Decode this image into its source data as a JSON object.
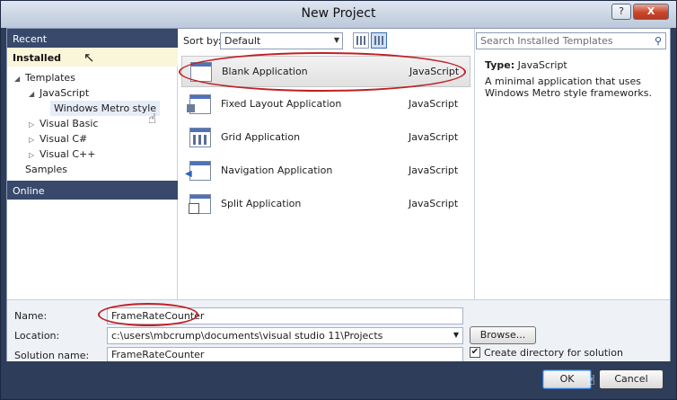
{
  "window": {
    "title": "New Project",
    "help_label": "?",
    "close_label": "X"
  },
  "sidebar": {
    "recent": "Recent",
    "installed": "Installed",
    "online": "Online",
    "tree": [
      {
        "label": "Templates",
        "expanded": true
      },
      {
        "label": "JavaScript",
        "expanded": true
      },
      {
        "label": "Windows Metro style",
        "selected": true
      },
      {
        "label": "Visual Basic",
        "expanded": false
      },
      {
        "label": "Visual C#",
        "expanded": false
      },
      {
        "label": "Visual C++",
        "expanded": false
      },
      {
        "label": "Samples"
      }
    ]
  },
  "toolbar": {
    "sort_label": "Sort by:",
    "sort_value": "Default"
  },
  "templates": [
    {
      "name": "Blank Application",
      "language": "JavaScript",
      "icon": "blank-app-icon",
      "selected": true
    },
    {
      "name": "Fixed Layout Application",
      "language": "JavaScript",
      "icon": "fixed-layout-app-icon"
    },
    {
      "name": "Grid Application",
      "language": "JavaScript",
      "icon": "grid-app-icon"
    },
    {
      "name": "Navigation Application",
      "language": "JavaScript",
      "icon": "navigation-app-icon"
    },
    {
      "name": "Split Application",
      "language": "JavaScript",
      "icon": "split-app-icon"
    }
  ],
  "search": {
    "placeholder": "Search Installed Templates"
  },
  "details": {
    "type_label": "Type:",
    "type_value": "JavaScript",
    "description": "A minimal application that uses Windows Metro style frameworks."
  },
  "form": {
    "name_label": "Name:",
    "name_value": "FrameRateCounter",
    "location_label": "Location:",
    "location_value": "c:\\users\\mbcrump\\documents\\visual studio 11\\Projects",
    "solution_label": "Solution name:",
    "solution_value": "FrameRateCounter",
    "browse_label": "Browse...",
    "create_dir_label": "Create directory for solution",
    "create_dir_checked": true
  },
  "buttons": {
    "ok": "OK",
    "cancel": "Cancel"
  },
  "colors": {
    "chrome": "#2d3d5a",
    "accent_ring": "#c02025",
    "selection": "#fbf5d9"
  }
}
